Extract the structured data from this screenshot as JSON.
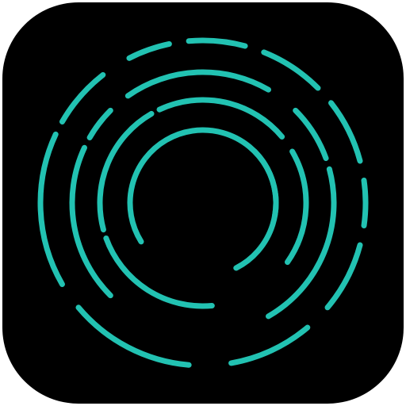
{
  "icon": {
    "name": "concentric-dashed-rings-icon",
    "background_color": "#000000",
    "stroke_color": "#22c2b2"
  }
}
